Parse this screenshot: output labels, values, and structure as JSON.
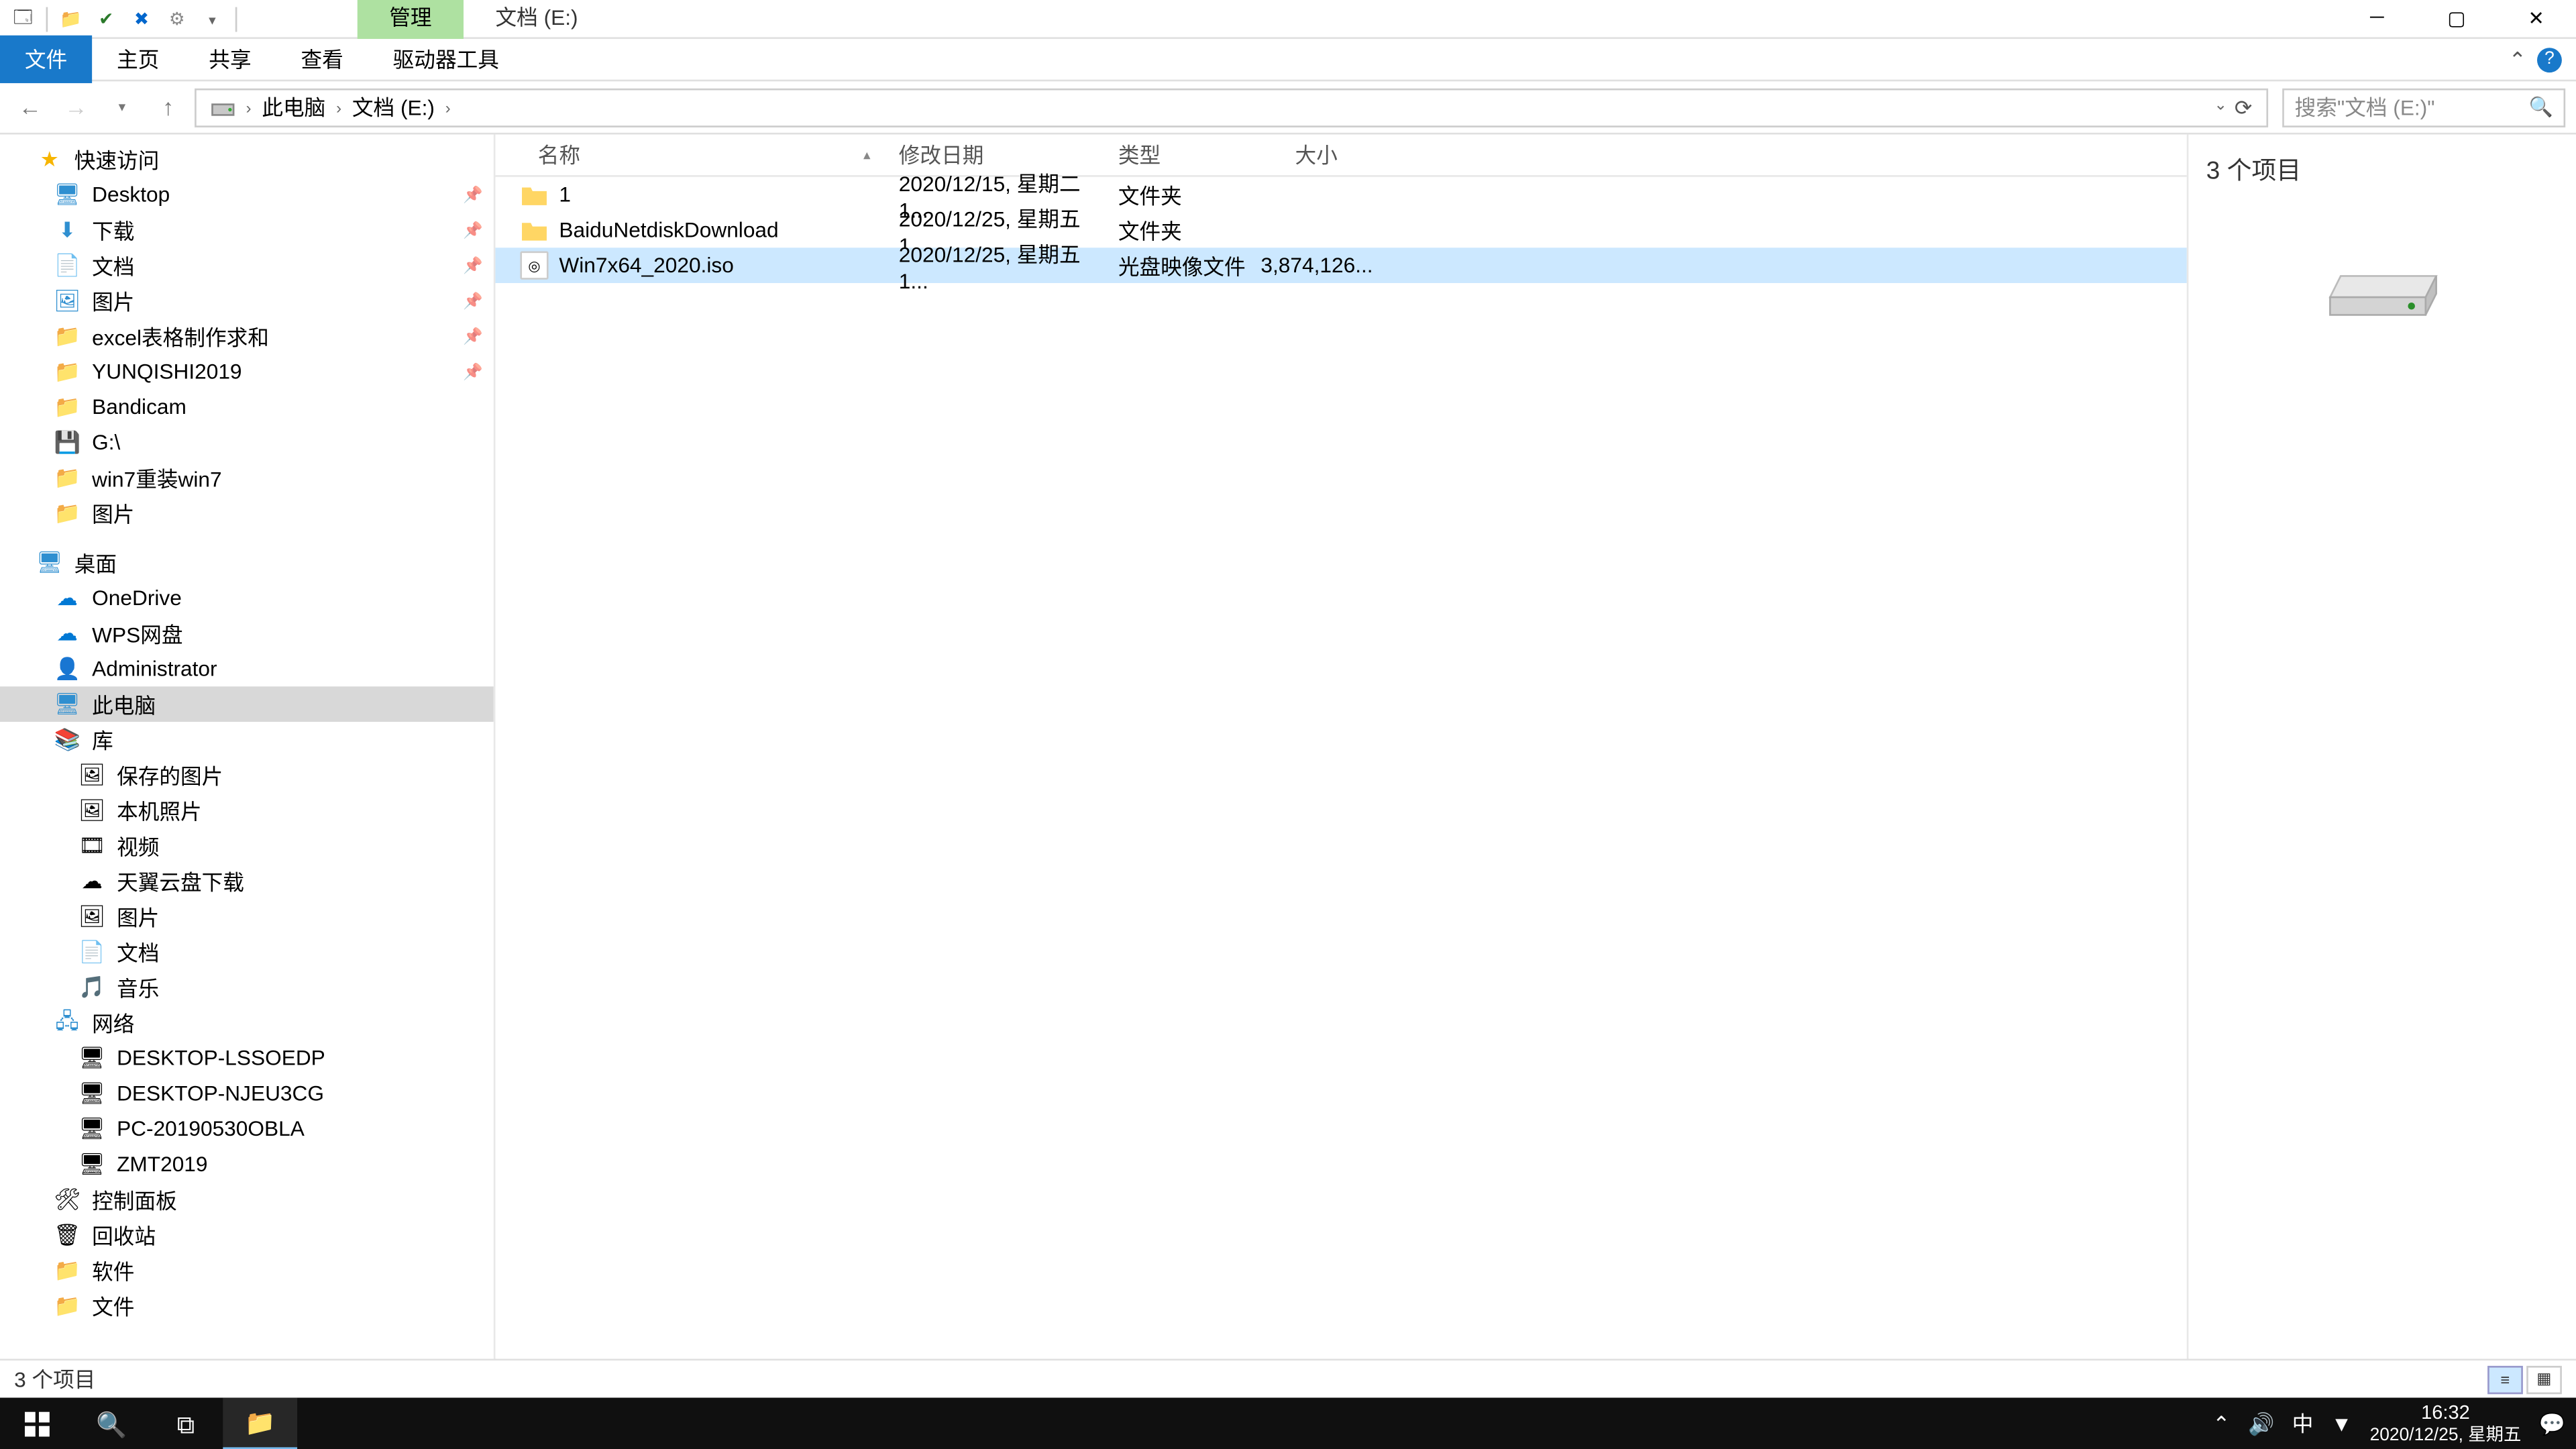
{
  "titlebar": {
    "manage_tab": "管理",
    "location_tab": "文档 (E:)"
  },
  "menu": {
    "file": "文件",
    "home": "主页",
    "share": "共享",
    "view": "查看",
    "drivetools": "驱动器工具"
  },
  "nav": {
    "back": "←",
    "fwd": "→",
    "up": "↑"
  },
  "breadcrumb": {
    "root": "此电脑",
    "drive": "文档 (E:)"
  },
  "search": {
    "placeholder": "搜索\"文档 (E:)\""
  },
  "sidebar": {
    "quick": "快速访问",
    "pinned": [
      {
        "label": "Desktop"
      },
      {
        "label": "下载"
      },
      {
        "label": "文档"
      },
      {
        "label": "图片"
      },
      {
        "label": "excel表格制作求和"
      },
      {
        "label": "YUNQISHI2019"
      },
      {
        "label": "Bandicam"
      },
      {
        "label": "G:\\"
      },
      {
        "label": "win7重装win7"
      },
      {
        "label": "图片"
      }
    ],
    "desktop": "桌面",
    "onedrive": "OneDrive",
    "wps": "WPS网盘",
    "user": "Administrator",
    "thispc": "此电脑",
    "libs": "库",
    "libitems": [
      {
        "label": "保存的图片"
      },
      {
        "label": "本机照片"
      },
      {
        "label": "视频"
      },
      {
        "label": "天翼云盘下载"
      },
      {
        "label": "图片"
      },
      {
        "label": "文档"
      },
      {
        "label": "音乐"
      }
    ],
    "network": "网络",
    "netitems": [
      {
        "label": "DESKTOP-LSSOEDP"
      },
      {
        "label": "DESKTOP-NJEU3CG"
      },
      {
        "label": "PC-20190530OBLA"
      },
      {
        "label": "ZMT2019"
      }
    ],
    "cpanel": "控制面板",
    "recycle": "回收站",
    "soft": "软件",
    "docs": "文件"
  },
  "columns": {
    "name": "名称",
    "date": "修改日期",
    "type": "类型",
    "size": "大小"
  },
  "files": [
    {
      "name": "1",
      "date": "2020/12/15, 星期二 1...",
      "type": "文件夹",
      "size": "",
      "kind": "folder"
    },
    {
      "name": "BaiduNetdiskDownload",
      "date": "2020/12/25, 星期五 1...",
      "type": "文件夹",
      "size": "",
      "kind": "folder"
    },
    {
      "name": "Win7x64_2020.iso",
      "date": "2020/12/25, 星期五 1...",
      "type": "光盘映像文件",
      "size": "3,874,126...",
      "kind": "iso",
      "selected": true
    }
  ],
  "preview": {
    "count": "3 个项目"
  },
  "status": {
    "text": "3 个项目"
  },
  "taskbar": {
    "time": "16:32",
    "date": "2020/12/25, 星期五",
    "ime": "中"
  }
}
